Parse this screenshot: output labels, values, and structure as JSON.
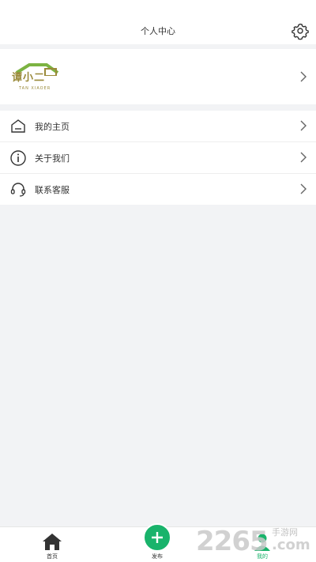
{
  "header": {
    "title": "个人中心",
    "settings_icon": "gear-icon"
  },
  "profile": {
    "brand_text": "谭小二",
    "brand_sub": "TAN XIAOER",
    "logo_color": "#9a8a3a"
  },
  "menu": {
    "items": [
      {
        "label": "我的主页",
        "icon": "home-outline-icon"
      },
      {
        "label": "关于我们",
        "icon": "info-icon"
      },
      {
        "label": "联系客服",
        "icon": "headset-icon"
      }
    ]
  },
  "tabbar": {
    "home_label": "首页",
    "publish_label": "发布",
    "mine_label": "我的",
    "accent": "#19b36b"
  },
  "watermark": {
    "number": "2265",
    "cn": "手游网",
    "com": ".com"
  }
}
